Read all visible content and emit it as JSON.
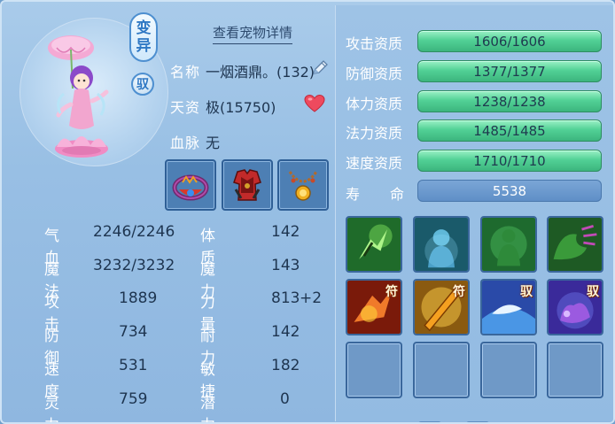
{
  "header": {
    "view_detail": "查看宠物详情"
  },
  "badges": {
    "mutant": "变异",
    "mount": "驭"
  },
  "info": {
    "name_label": "名称",
    "name_value": "一烟酒鼎。(132)",
    "aptitude_label": "天资",
    "aptitude_value": "极(15750)",
    "bloodline_label": "血脉",
    "bloodline_value": "无"
  },
  "equipment": [
    {
      "name": "necklace-ring-icon"
    },
    {
      "name": "armor-icon"
    },
    {
      "name": "bead-necklace-icon"
    }
  ],
  "stats_left": [
    {
      "label": "气血",
      "value": "2246/2246"
    },
    {
      "label": "魔法",
      "value": "3232/3232"
    },
    {
      "label": "攻击",
      "value": "1889"
    },
    {
      "label": "防御",
      "value": "734"
    },
    {
      "label": "速度",
      "value": "531"
    },
    {
      "label": "灵力",
      "value": "759"
    }
  ],
  "stats_right": [
    {
      "label": "体质",
      "value": "142",
      "bonus": ""
    },
    {
      "label": "魔力",
      "value": "143",
      "bonus": ""
    },
    {
      "label": "力量",
      "value": "813",
      "bonus": "+2"
    },
    {
      "label": "耐力",
      "value": "142",
      "bonus": ""
    },
    {
      "label": "敏捷",
      "value": "182",
      "bonus": ""
    },
    {
      "label": "潜力",
      "value": "0",
      "bonus": ""
    }
  ],
  "qualities": [
    {
      "label": "攻击资质",
      "value": "1606/1606"
    },
    {
      "label": "防御资质",
      "value": "1377/1377"
    },
    {
      "label": "体力资质",
      "value": "1238/1238"
    },
    {
      "label": "法力资质",
      "value": "1485/1485"
    },
    {
      "label": "速度资质",
      "value": "1710/1710"
    }
  ],
  "lifespan": {
    "label_a": "寿",
    "label_b": "命",
    "value": "5538"
  },
  "skills": [
    {
      "name": "green-strike-skill-icon",
      "tag": ""
    },
    {
      "name": "blue-defense-skill-icon",
      "tag": ""
    },
    {
      "name": "green-aura-skill-icon",
      "tag": ""
    },
    {
      "name": "green-claw-skill-icon",
      "tag": ""
    },
    {
      "name": "red-fist-skill-icon",
      "tag": "符"
    },
    {
      "name": "golden-sword-skill-icon",
      "tag": "符"
    },
    {
      "name": "blue-beast-skill-icon",
      "tag": "驭"
    },
    {
      "name": "purple-claw-skill-icon",
      "tag": "驭"
    }
  ],
  "colors": {
    "bar_green": "#52d196",
    "bonus_yellow": "#f5e43a",
    "label_white": "#ffffff",
    "value_dark": "#1e3550"
  }
}
